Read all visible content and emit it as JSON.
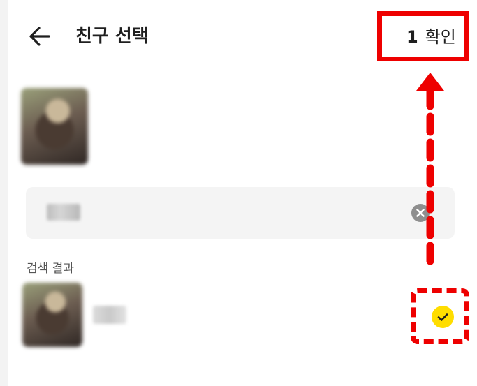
{
  "header": {
    "back_icon": "arrow-left-icon",
    "title": "친구 선택",
    "confirm_count": "1",
    "confirm_label": "확인"
  },
  "search": {
    "clear_icon": "close-circle-icon"
  },
  "results": {
    "section_label": "검색 결과",
    "items": [
      {
        "selected": true,
        "check_icon": "checkmark-icon"
      }
    ]
  },
  "colors": {
    "highlight": "#ee0000",
    "check_fill": "#ffdd00"
  }
}
